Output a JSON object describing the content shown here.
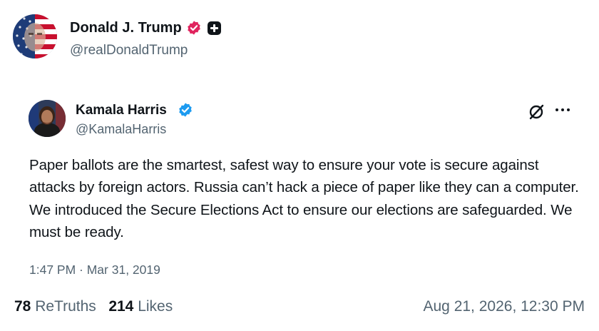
{
  "post": {
    "author_name": "Donald J. Trump",
    "author_handle": "@realDonaldTrump",
    "verified_icon": "verified-badge-icon",
    "plus_icon": "plus-square-icon",
    "accent_color": "#e0245e"
  },
  "quoted": {
    "author_name": "Kamala Harris",
    "author_handle": "@KamalaHarris",
    "verified_icon": "verified-badge-icon",
    "verified_color": "#1d9bf0",
    "body": "Paper ballots are the smartest, safest way to ensure your vote is secure against attacks by foreign actors. Russia can’t hack a piece of paper like they can a computer. We introduced the Secure Elections Act to ensure our elections are safeguarded. We must be ready.",
    "timestamp": "1:47 PM · Mar 31, 2019",
    "icons": [
      "unlink-icon",
      "more-icon"
    ]
  },
  "stats": {
    "retruths_count": "78",
    "retruths_label": "ReTruths",
    "likes_count": "214",
    "likes_label": "Likes",
    "post_timestamp": "Aug 21, 2026, 12:30 PM"
  }
}
